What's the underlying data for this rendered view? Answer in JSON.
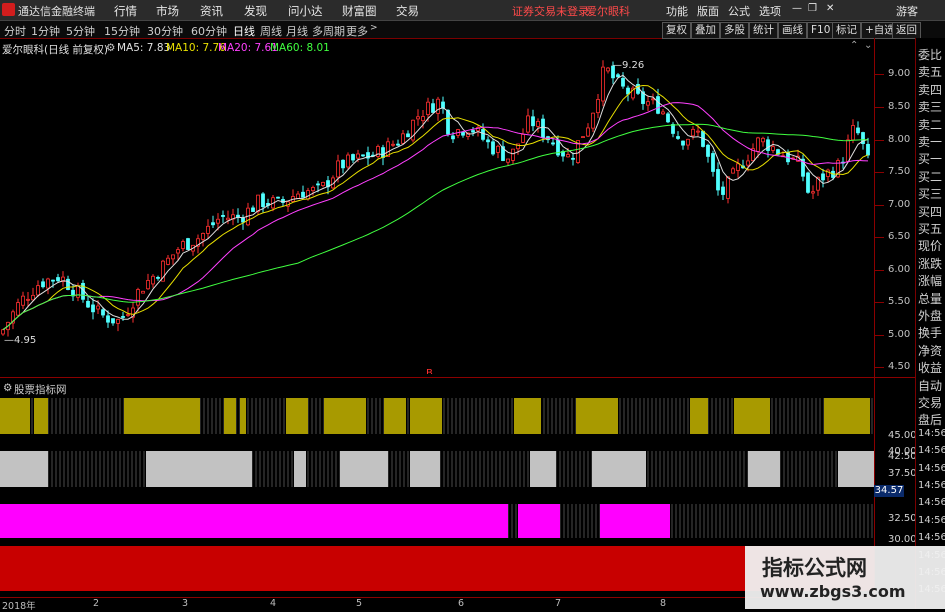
{
  "app": {
    "name": "通达信金融终端"
  },
  "menu": [
    "行情",
    "市场",
    "资讯",
    "发现",
    "问小达",
    "财富圈",
    "交易"
  ],
  "notice": "证券交易未登录",
  "notice_stock": "爱尔眼科",
  "right_menu": [
    "功能",
    "版面",
    "公式",
    "选项"
  ],
  "guest": "游客",
  "toolbar": {
    "periods": [
      "分时",
      "1分钟",
      "5分钟",
      "15分钟",
      "30分钟",
      "60分钟",
      "日线",
      "周线",
      "月线",
      "多周期",
      "更多"
    ],
    "active_period": "日线",
    "right_buttons": [
      "复权",
      "叠加",
      "多股",
      "统计",
      "画线",
      "F10",
      "标记",
      "+自选",
      "返回"
    ]
  },
  "stock_info": {
    "name": "爱尔眼科(日线 前复权)",
    "ma5": "MA5: 7.83",
    "ma10": "MA10: 7.76",
    "ma20": "MA20: 7.61",
    "ma60": "MA60: 8.01",
    "colors": {
      "ma5": "#e0e0e0",
      "ma10": "#e8e000",
      "ma20": "#ff40ff",
      "ma60": "#40ff40"
    }
  },
  "price_axis": [
    "9.00",
    "8.50",
    "8.00",
    "7.50",
    "7.00",
    "6.50",
    "6.00",
    "5.50",
    "5.00",
    "4.50"
  ],
  "annotations": {
    "high": "9.26",
    "low": "4.95",
    "marker": "B"
  },
  "right_panel": [
    "委比",
    "卖五",
    "卖四",
    "卖三",
    "卖二",
    "卖一",
    "买一",
    "买二",
    "买三",
    "买四",
    "买五",
    "现价",
    "涨跌",
    "涨幅",
    "总量",
    "外盘",
    "换手",
    "净资",
    "收益",
    "自动",
    "交易",
    "盘后",
    "14:56",
    "14:56",
    "14:56",
    "14:56",
    "14:56",
    "14:56",
    "14:56",
    "14:56",
    "14:56",
    "14:56"
  ],
  "indicator_name": "股票指标网",
  "sub_axis": {
    "band1": [
      "45.00",
      "42.50"
    ],
    "band2": [
      "40.00",
      "37.50"
    ],
    "badge": "34.57",
    "band3": [
      "32.50",
      "30.00"
    ]
  },
  "dates": [
    "2018年",
    "2",
    "3",
    "4",
    "5",
    "6",
    "7",
    "8"
  ],
  "watermark": {
    "line1": "指标公式网",
    "line2": "www.zbgs3.com"
  },
  "colors": {
    "band1": "#a89a00",
    "band2": "#c2c2c2",
    "band3": "#ff00ff",
    "band4": "#c80000",
    "up": "#ff3030",
    "down": "#50ffff"
  }
}
